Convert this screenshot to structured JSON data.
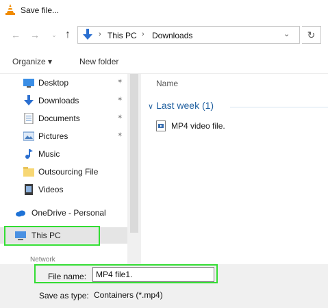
{
  "window": {
    "title": "Save file..."
  },
  "navigation": {
    "recent_glyph": "⌄"
  },
  "address": {
    "items": [
      "This PC",
      "Downloads"
    ],
    "separator": "›",
    "dropdown_glyph": "⌄",
    "refresh_glyph": "↻"
  },
  "toolbar": {
    "organize_label": "Organize ▾",
    "new_folder_label": "New folder"
  },
  "sidebar": {
    "quick_access": [
      {
        "label": "Desktop",
        "icon": "desktop-icon",
        "pinned": true
      },
      {
        "label": "Downloads",
        "icon": "downloads-icon",
        "pinned": true
      },
      {
        "label": "Documents",
        "icon": "documents-icon",
        "pinned": true
      },
      {
        "label": "Pictures",
        "icon": "pictures-icon",
        "pinned": true
      },
      {
        "label": "Music",
        "icon": "music-icon",
        "pinned": false
      },
      {
        "label": "Outsourcing File",
        "icon": "folder-icon",
        "pinned": false
      },
      {
        "label": "Videos",
        "icon": "videos-icon",
        "pinned": false
      }
    ],
    "onedrive_label": "OneDrive - Personal",
    "thispc_label": "This PC",
    "network_label": "Network",
    "pin_glyph": "✶"
  },
  "content": {
    "column_name": "Name",
    "group_label": "Last week (1)",
    "group_chevron": "∨",
    "files": [
      {
        "name": "MP4 video file.",
        "icon": "video-file-icon"
      }
    ]
  },
  "form": {
    "file_name_label": "File name:",
    "file_name_value": "MP4 file1.",
    "save_as_type_label": "Save as type:",
    "save_as_type_value": "Containers (*.mp4)"
  },
  "colors": {
    "highlight": "#33dd33",
    "accent": "#1f5f9f"
  }
}
